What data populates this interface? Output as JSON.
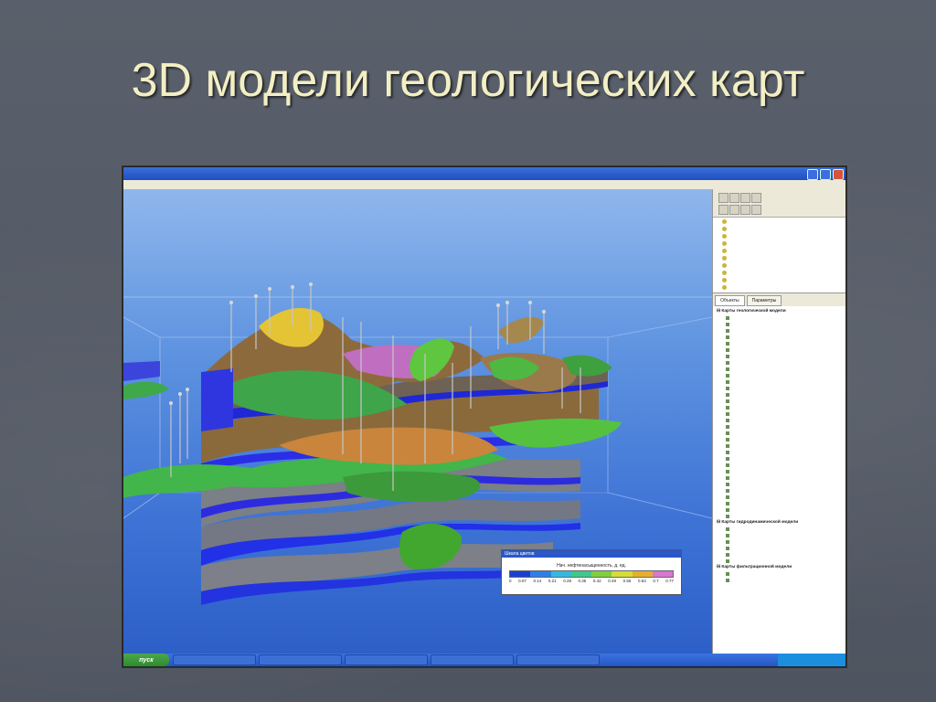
{
  "slide": {
    "title": "3D модели геологических карт"
  },
  "window": {
    "title": "",
    "menu": [],
    "legend": {
      "title": "Шкала цветов",
      "caption": "Нач. нефтенасыщенность, д. ед.",
      "colors": [
        "#1a3fd0",
        "#2f7fe8",
        "#35b8e0",
        "#3fc98a",
        "#7fd040",
        "#d6dd36",
        "#e6b02c",
        "#d777d0"
      ],
      "ticks": [
        "0",
        "0.07",
        "0.14",
        "0.21",
        "0.28",
        "0.35",
        "0.42",
        "0.49",
        "0.56",
        "0.63",
        "0.7",
        "0.77"
      ]
    },
    "layers": [
      "",
      "",
      "",
      "",
      "",
      "",
      "",
      "",
      "",
      ""
    ],
    "tabs": [
      "Объекты",
      "Параметры"
    ],
    "tree": {
      "groups": [
        "Карты геологической модели",
        "Карты гидродинамической модели",
        "Карты фильтрационной модели"
      ],
      "group1_items": [
        "",
        "",
        "",
        "",
        "",
        "",
        "",
        "",
        "",
        "",
        "",
        "",
        "",
        "",
        "",
        "",
        "",
        "",
        "",
        "",
        "",
        "",
        "",
        "",
        "",
        "",
        "",
        "",
        "",
        "",
        "",
        ""
      ],
      "group2_items": [
        "",
        "",
        "",
        "",
        "",
        ""
      ],
      "group3_items": [
        "",
        ""
      ]
    }
  },
  "taskbar": {
    "start": "пуск",
    "tasks": [
      "",
      "",
      "",
      "",
      ""
    ],
    "clock": ""
  }
}
